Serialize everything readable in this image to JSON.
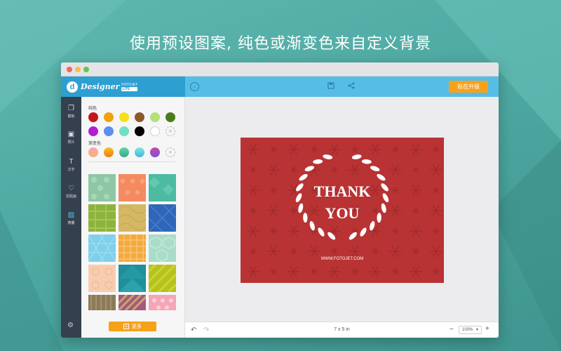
{
  "headline": "使用预设图案, 纯色或渐变色来自定义背景",
  "app": {
    "logo_mark": "d",
    "logo_name": "Designer",
    "logo_brand": "FOTOJET",
    "logo_edition": "LITE",
    "upgrade_label": "现在升级"
  },
  "toolbar": {
    "back_icon": "back-icon",
    "save_icon": "save-icon",
    "share_icon": "share-icon"
  },
  "nav": [
    {
      "label": "模板",
      "icon": "template-icon"
    },
    {
      "label": "照片",
      "icon": "photo-icon"
    },
    {
      "label": "文字",
      "icon": "text-icon"
    },
    {
      "label": "剪贴画",
      "icon": "clipart-icon"
    },
    {
      "label": "背景",
      "icon": "background-icon",
      "active": true
    }
  ],
  "panel": {
    "solid_label": "纯色",
    "solid_colors": [
      "#c4161c",
      "#f0a30a",
      "#f7e01a",
      "#8b5a2b",
      "#b5e07a",
      "#4a7d1a",
      "#b21fd0",
      "#5b8ff0",
      "#6fe0c5",
      "#000000",
      "#ffffff"
    ],
    "gradient_label": "渐变色",
    "gradient_colors": [
      [
        "#f9a3b8",
        "#f5b46e"
      ],
      [
        "#f3c31a",
        "#f27a1a"
      ],
      [
        "#5fd6a9",
        "#3aa889"
      ],
      [
        "#7ce9e2",
        "#4ab3e0"
      ],
      [
        "#c74aa6",
        "#7a52d8"
      ]
    ],
    "more_label": "更多"
  },
  "canvas": {
    "card_bg": "#b93334",
    "title_line1": "THANK",
    "title_line2": "YOU",
    "url": "WWW.FOTOJET.COM"
  },
  "bottom": {
    "size": "7 x 5 in",
    "zoom": "100%"
  }
}
